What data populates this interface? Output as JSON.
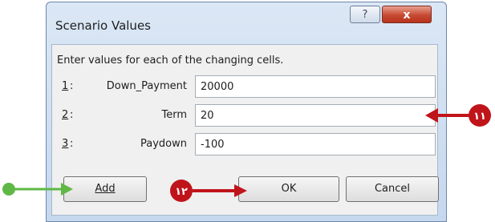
{
  "dialog": {
    "title": "Scenario Values",
    "help_label": "?",
    "close_label": "x"
  },
  "form": {
    "instructions": "Enter values for each of the changing cells.",
    "rows": [
      {
        "num": "1",
        "colon": ":",
        "label": "Down_Payment",
        "value": "20000"
      },
      {
        "num": "2",
        "colon": ":",
        "label": "Term",
        "value": "20"
      },
      {
        "num": "3",
        "colon": ":",
        "label": "Paydown",
        "value": "-100"
      }
    ]
  },
  "buttons": {
    "add": "Add",
    "ok": "OK",
    "cancel": "Cancel"
  },
  "callouts": {
    "step_11": "١١",
    "step_12": "١٢"
  },
  "colors": {
    "callout_red": "#c0141b",
    "pointer_green": "#5fb845"
  }
}
